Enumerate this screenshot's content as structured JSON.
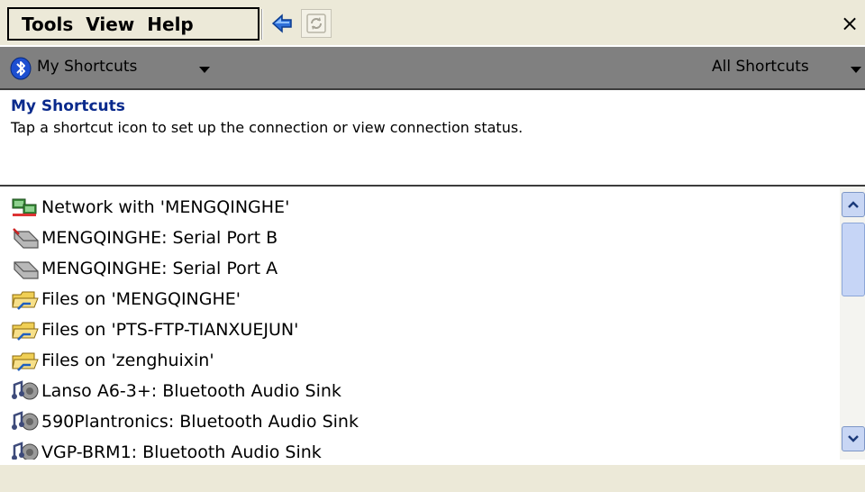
{
  "menubar": {
    "items": [
      "Tools",
      "View",
      "Help"
    ],
    "back_icon": "back-arrow-icon",
    "forward_icon": "forward-refresh-icon",
    "close_label": "×"
  },
  "commandbar": {
    "icon": "bluetooth-icon",
    "left_label": "My Shortcuts",
    "right_label": "All Shortcuts"
  },
  "header": {
    "title": "My Shortcuts",
    "description": "Tap a shortcut icon to set up the connection or view connection status."
  },
  "shortcuts": [
    {
      "label": "Network with 'MENGQINGHE'",
      "icon": "network-icon"
    },
    {
      "label": "MENGQINGHE: Serial Port B",
      "icon": "serial-cable-icon"
    },
    {
      "label": "MENGQINGHE: Serial Port A",
      "icon": "serial-cable-icon"
    },
    {
      "label": "Files on 'MENGQINGHE'",
      "icon": "shared-folder-icon"
    },
    {
      "label": "Files on 'PTS-FTP-TIANXUEJUN'",
      "icon": "shared-folder-icon"
    },
    {
      "label": "Files on 'zenghuixin'",
      "icon": "shared-folder-icon"
    },
    {
      "label": "Lanso A6-3+: Bluetooth Audio Sink",
      "icon": "audio-sink-icon"
    },
    {
      "label": "590Plantronics: Bluetooth Audio Sink",
      "icon": "audio-sink-icon"
    },
    {
      "label": "VGP-BRM1: Bluetooth Audio Sink",
      "icon": "audio-sink-icon"
    }
  ],
  "scrollbar": {
    "up_icon": "chevron-up-icon",
    "down_icon": "chevron-down-icon"
  },
  "colors": {
    "title_blue": "#0a2a8c",
    "toolbar_gray": "#808080",
    "menubar_beige": "#ece9d8",
    "scroll_blue": "#c6d5f6"
  }
}
